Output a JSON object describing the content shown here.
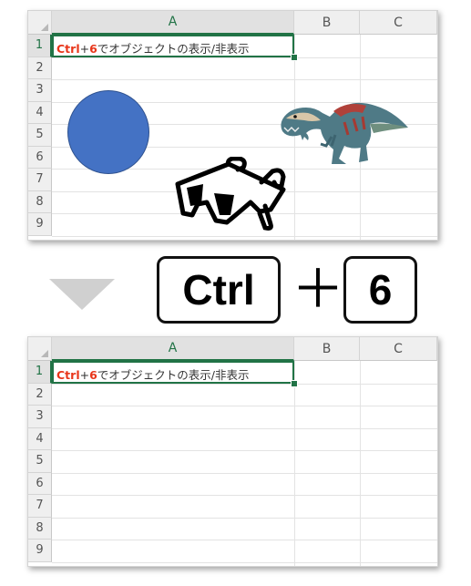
{
  "columns": [
    "A",
    "B",
    "C"
  ],
  "rows": [
    "1",
    "2",
    "3",
    "4",
    "5",
    "6",
    "7",
    "8",
    "9"
  ],
  "cell_a1": {
    "part1_red": "Ctrl",
    "part2": "+",
    "part3_red": "6",
    "part4": "でオブジェクトの表示/非表示"
  },
  "shortcut": {
    "key1": "Ctrl",
    "plus": "＋",
    "key2": "6"
  },
  "colors": {
    "accent": "#217346",
    "shape_fill": "#4472c4",
    "highlight_text": "#e8361a"
  },
  "icons": {
    "objects": [
      "circle-shape",
      "dinosaur-image",
      "3d-glasses-icon"
    ],
    "transition": "down-arrow-icon"
  }
}
